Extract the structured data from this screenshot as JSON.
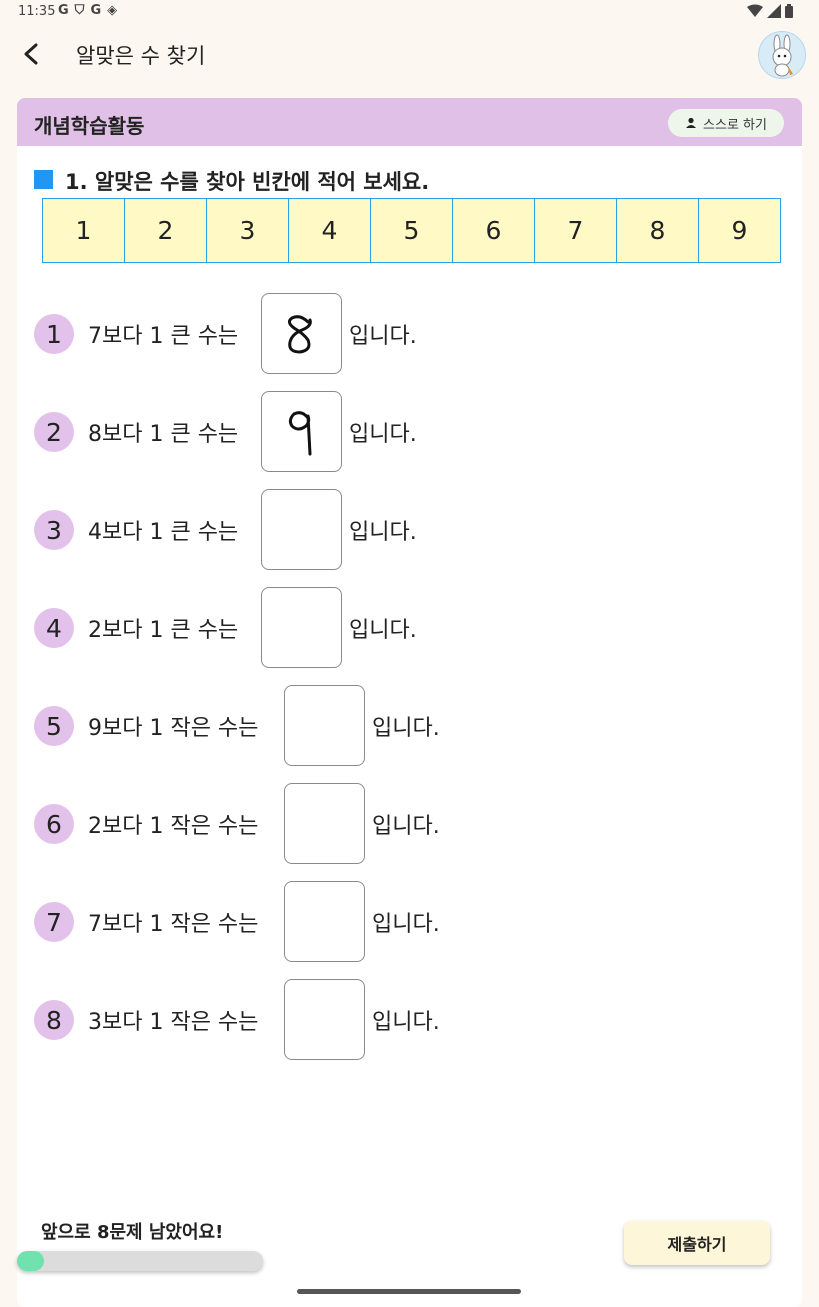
{
  "status": {
    "time": "11:35",
    "left_icons": [
      "G",
      "shield-icon",
      "G",
      "diamond-icon"
    ],
    "right_icons": [
      "wifi-icon",
      "signal-icon",
      "battery-icon"
    ]
  },
  "appbar": {
    "title": "알맞은 수 찾기"
  },
  "section": {
    "title": "개념학습활동",
    "self_button_label": "스스로 하기"
  },
  "question": {
    "title": "1. 알맞은 수를 찾아 빈칸에 적어 보세요.",
    "numbers": [
      "1",
      "2",
      "3",
      "4",
      "5",
      "6",
      "7",
      "8",
      "9"
    ]
  },
  "problems": [
    {
      "num": "1",
      "prefix": "7보다 1 큰 수는",
      "answer": "8",
      "suffix": "입니다."
    },
    {
      "num": "2",
      "prefix": "8보다 1 큰 수는",
      "answer": "9",
      "suffix": "입니다."
    },
    {
      "num": "3",
      "prefix": "4보다 1 큰 수는",
      "answer": "",
      "suffix": "입니다."
    },
    {
      "num": "4",
      "prefix": "2보다 1 큰 수는",
      "answer": "",
      "suffix": "입니다."
    },
    {
      "num": "5",
      "prefix": "9보다 1 작은 수는",
      "answer": "",
      "suffix": "입니다."
    },
    {
      "num": "6",
      "prefix": "2보다 1 작은 수는",
      "answer": "",
      "suffix": "입니다."
    },
    {
      "num": "7",
      "prefix": "7보다 1 작은 수는",
      "answer": "",
      "suffix": "입니다."
    },
    {
      "num": "8",
      "prefix": "3보다 1 작은 수는",
      "answer": "",
      "suffix": "입니다."
    }
  ],
  "footer": {
    "remaining_text": "앞으로 8문제 남았어요!",
    "progress_fraction": 0.11,
    "submit_label": "제출하기"
  },
  "colors": {
    "accent_blue": "#2196f3",
    "section_purple": "#e0c0e6",
    "number_cell_yellow": "#fff9c6",
    "progress_green": "#6fe2b0"
  }
}
